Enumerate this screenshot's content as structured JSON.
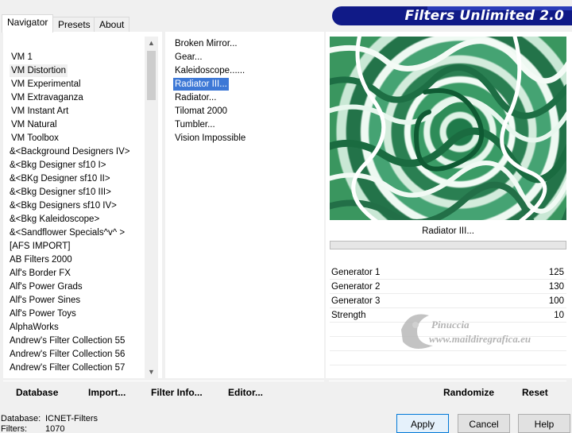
{
  "window": {
    "title": "Filters Unlimited 2.0"
  },
  "tabs": [
    {
      "label": "Navigator",
      "active": true
    },
    {
      "label": "Presets",
      "active": false
    },
    {
      "label": "About",
      "active": false
    }
  ],
  "categories": [
    {
      "label": "VM 1"
    },
    {
      "label": "VM Distortion",
      "selected": true
    },
    {
      "label": "VM Experimental"
    },
    {
      "label": "VM Extravaganza"
    },
    {
      "label": "VM Instant Art"
    },
    {
      "label": "VM Natural"
    },
    {
      "label": "VM Toolbox"
    },
    {
      "label": "&<Background Designers IV>"
    },
    {
      "label": "&<Bkg Designer sf10 I>"
    },
    {
      "label": "&<BKg Designer sf10 II>"
    },
    {
      "label": "&<Bkg Designer sf10 III>"
    },
    {
      "label": "&<Bkg Designers sf10 IV>"
    },
    {
      "label": "&<Bkg Kaleidoscope>"
    },
    {
      "label": "&<Sandflower Specials^v^ >"
    },
    {
      "label": "[AFS IMPORT]"
    },
    {
      "label": "AB Filters 2000"
    },
    {
      "label": "Alf's Border FX"
    },
    {
      "label": "Alf's Power Grads"
    },
    {
      "label": "Alf's Power Sines"
    },
    {
      "label": "Alf's Power Toys"
    },
    {
      "label": "AlphaWorks"
    },
    {
      "label": "Andrew's Filter Collection 55"
    },
    {
      "label": "Andrew's Filter Collection 56"
    },
    {
      "label": "Andrew's Filter Collection 57"
    }
  ],
  "filters": [
    {
      "label": "Broken Mirror..."
    },
    {
      "label": "Gear..."
    },
    {
      "label": "Kaleidoscope......"
    },
    {
      "label": "Radiator III...",
      "selected": true
    },
    {
      "label": "Radiator..."
    },
    {
      "label": "Tilomat 2000"
    },
    {
      "label": "Tumbler..."
    },
    {
      "label": "Vision Impossible"
    }
  ],
  "preview": {
    "filter_name": "Radiator III..."
  },
  "parameters": [
    {
      "name": "Generator 1",
      "value": "125"
    },
    {
      "name": "Generator 2",
      "value": "130"
    },
    {
      "name": "Generator 3",
      "value": "100"
    },
    {
      "name": "Strength",
      "value": "10"
    }
  ],
  "watermark": {
    "name": "Pinuccia",
    "url": "www.maildiregrafica.eu"
  },
  "left_toolbar": {
    "database": "Database",
    "import": "Import...",
    "filter_info": "Filter Info...",
    "editor": "Editor..."
  },
  "right_toolbar": {
    "randomize": "Randomize",
    "reset": "Reset"
  },
  "status": {
    "database_label": "Database:",
    "database_value": "ICNET-Filters",
    "filters_label": "Filters:",
    "filters_value": "1070"
  },
  "buttons": {
    "apply": "Apply",
    "cancel": "Cancel",
    "help": "Help"
  },
  "colors": {
    "banner": "#101a87",
    "selection": "#3d78d6",
    "preview_green": "#2e8c58"
  }
}
